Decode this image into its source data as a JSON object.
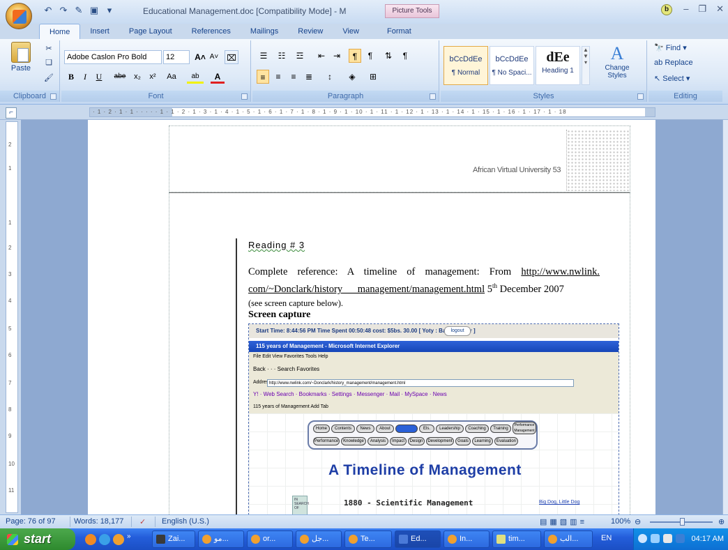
{
  "titlebar": {
    "title": "Educational Management.doc [Compatibility Mode] - M",
    "contextual_tab": "Picture Tools",
    "help": "b"
  },
  "tabs": [
    "Home",
    "Insert",
    "Page Layout",
    "References",
    "Mailings",
    "Review",
    "View",
    "Format"
  ],
  "ribbon": {
    "clipboard": {
      "paste": "Paste",
      "label": "Clipboard"
    },
    "font": {
      "family": "Adobe Caslon Pro Bold",
      "size": "12",
      "label": "Font"
    },
    "paragraph": {
      "label": "Paragraph"
    },
    "styles": {
      "items": [
        {
          "sample": "bCcDdEe",
          "name": "¶ Normal"
        },
        {
          "sample": "bCcDdEe",
          "name": "¶ No Spaci..."
        },
        {
          "sample": "dEe",
          "name": "Heading 1"
        }
      ],
      "change": "Change Styles",
      "label": "Styles"
    },
    "editing": {
      "find": "Find",
      "replace": "Replace",
      "select": "Select",
      "label": "Editing"
    }
  },
  "ruler": "· 1 · 2 · 1 · 1 · · · · · 1 · 1 · 2 · 1 · 3 · 1 · 4 · 1 · 5 · 1 · 6 · 1 · 7 · 1 · 8 · 1 · 9 · 1 · 10 · 1 · 11 · 1 · 12 · 1 · 13 · 1 · 14 · 1 · 15 · 1 · 16 · 1 · 17 · 1 · 18",
  "vruler_ticks": [
    "2",
    "1",
    "1",
    "2",
    "3",
    "4",
    "5",
    "6",
    "7",
    "8",
    "9",
    "10",
    "11"
  ],
  "document": {
    "header_text": "African Virtual University  53",
    "reading": "Reading  # 3",
    "para_intro": "Complete reference: A timeline of management: From ",
    "link1": "http://www.nwlink.",
    "link2": "com/~Donclark/history  management/management.html",
    "date_pre": "  5",
    "date_sup": "th",
    "date_post": " December 2007",
    "para_end": "(see screen capture below).",
    "caption": "Screen capture"
  },
  "embed": {
    "topbar": "Start Time: 8:44:56 PM    Time Spent 00:50:48    cost: $5bs. 30.00    [ Yoty : Bas Member ]",
    "logout": "logout",
    "window_title": "115 years of Management - Microsoft Internet Explorer",
    "menu": "File   Edit   View   Favorites   Tools   Help",
    "toolbar": "Back  ·  ·  ·  Search   Favorites",
    "address": "Address",
    "address_url": "http://www.nwlink.com/~Donclark/history_management/management.html",
    "yahoo": "Y! ·                      Web Search · Bookmarks · Settings · Messenger · Mail · MySpace · News",
    "tab": "115 years of Management        Add Tab",
    "nav_row1": [
      "Home",
      "Contents",
      "News",
      "About",
      "Timeline",
      "Els.",
      "Leadership",
      "Coaching",
      "Training",
      "Performance Management"
    ],
    "nav_row2": [
      "Performance",
      "Knowledge",
      "Analysis",
      "Impact",
      "Design",
      "Development",
      "Goals",
      "Learning",
      "Evaluation"
    ],
    "heading": "A Timeline of Management",
    "sub": "1880 - Scientific Management",
    "side_link": "Big Dog, Little Dog",
    "book": "IN SEARCH OF"
  },
  "status": {
    "page": "Page: 76 of 97",
    "words": "Words: 18,177",
    "language": "English (U.S.)",
    "zoom": "100%"
  },
  "taskbar": {
    "start": "start",
    "buttons": [
      "Zai...",
      "مو...",
      "or...",
      "جل...",
      "Te...",
      "Ed...",
      "In...",
      "tim...",
      "الب..."
    ],
    "lang": "EN",
    "clock": "04:17 AM"
  }
}
